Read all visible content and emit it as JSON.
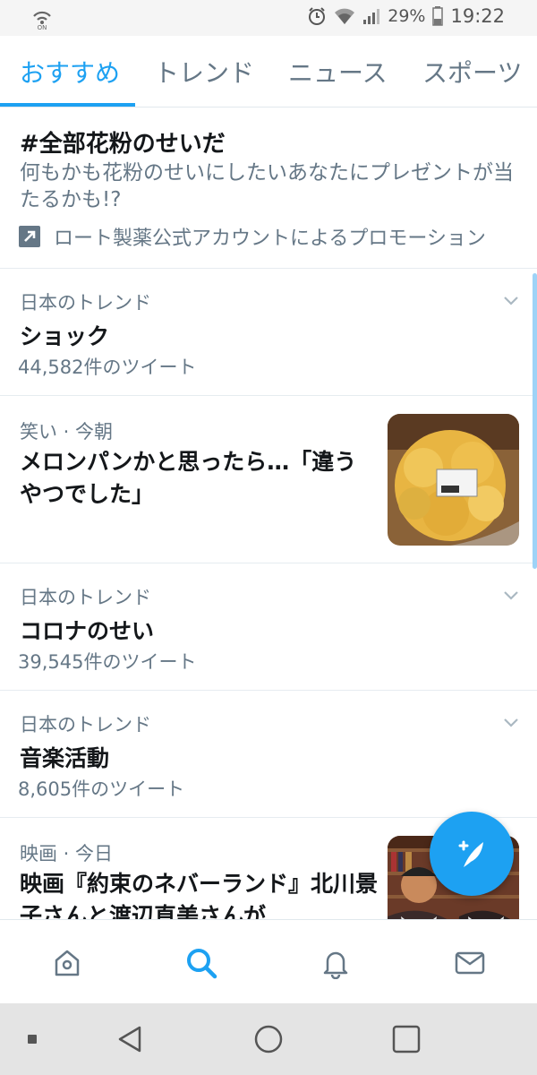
{
  "status_bar": {
    "battery_pct": "29%",
    "time": "19:22"
  },
  "tabs": [
    {
      "label": "おすすめ",
      "active": true
    },
    {
      "label": "トレンド",
      "active": false
    },
    {
      "label": "ニュース",
      "active": false
    },
    {
      "label": "スポーツ",
      "active": false
    }
  ],
  "promoted": {
    "title": "#全部花粉のせいだ",
    "description": "何もかも花粉のせいにしたいあなたにプレゼントが当たるかも!?",
    "promoted_by": "ロート製薬公式アカウントによるプロモーション"
  },
  "trends": [
    {
      "context": "日本のトレンド",
      "title": "ショック",
      "count": "44,582件のツイート"
    },
    {
      "context": "日本のトレンド",
      "title": "コロナのせい",
      "count": "39,545件のツイート"
    },
    {
      "context": "日本のトレンド",
      "title": "音楽活動",
      "count": "8,605件のツイート"
    }
  ],
  "news": [
    {
      "context": "笑い · 今朝",
      "title": "メロンパンかと思ったら…「違うやつでした」"
    },
    {
      "context": "映画 · 今日",
      "title": "映画『約束のネバーランド』北川景子さんと渡辺直美さんが"
    }
  ],
  "bottom_nav": [
    "home-icon",
    "search-icon",
    "notifications-icon",
    "messages-icon"
  ],
  "colors": {
    "accent": "#1da1f2",
    "secondary_text": "#657786"
  }
}
